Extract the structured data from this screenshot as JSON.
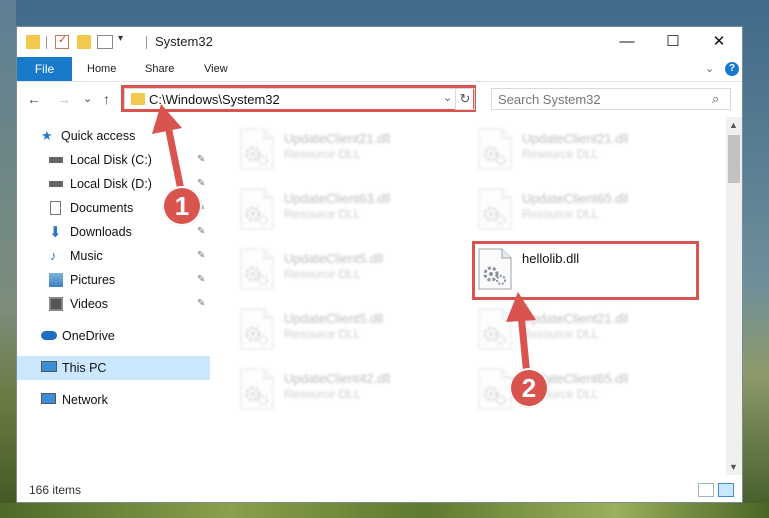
{
  "window": {
    "title": "System32",
    "minimize_glyph": "—",
    "maximize_glyph": "☐",
    "close_glyph": "✕"
  },
  "ribbon": {
    "tabs": [
      "File",
      "Home",
      "Share",
      "View"
    ],
    "help_glyph": "?",
    "expand_glyph": "⌄"
  },
  "nav": {
    "back_glyph": "←",
    "forward_glyph": "→",
    "recent_glyph": "⌄",
    "up_glyph": "↑",
    "address": "C:\\Windows\\System32",
    "refresh_glyph": "↻",
    "search_placeholder": "Search System32",
    "search_icon": "🔍"
  },
  "sidebar": {
    "items": [
      {
        "label": "Quick access",
        "icon": "star-icon",
        "pinned": false
      },
      {
        "label": "Local Disk (C:)",
        "icon": "drive-icon",
        "pinned": true
      },
      {
        "label": "Local Disk (D:)",
        "icon": "drive-icon",
        "pinned": true
      },
      {
        "label": "Documents",
        "icon": "document-icon",
        "pinned": true
      },
      {
        "label": "Downloads",
        "icon": "download-icon",
        "pinned": true
      },
      {
        "label": "Music",
        "icon": "music-icon",
        "pinned": true
      },
      {
        "label": "Pictures",
        "icon": "picture-icon",
        "pinned": true
      },
      {
        "label": "Videos",
        "icon": "video-icon",
        "pinned": true
      },
      {
        "label": "OneDrive",
        "icon": "cloud-icon",
        "pinned": false
      },
      {
        "label": "This PC",
        "icon": "computer-icon",
        "pinned": false,
        "selected": true
      },
      {
        "label": "Network",
        "icon": "network-icon",
        "pinned": false
      }
    ],
    "pin_glyph": "📌"
  },
  "files": [
    {
      "name": "UpdateClient21.dll",
      "type": "Resource DLL",
      "blurred": true
    },
    {
      "name": "UpdateClient21.dll",
      "type": "Resource DLL",
      "blurred": true
    },
    {
      "name": "UpdateClient63.dll",
      "type": "Resource DLL",
      "blurred": true
    },
    {
      "name": "UpdateClient65.dll",
      "type": "Resource DLL",
      "blurred": true
    },
    {
      "name": "UpdateClient5.dll",
      "type": "Resource DLL",
      "blurred": true
    },
    {
      "name": "hellolib.dll",
      "type": "",
      "blurred": false
    },
    {
      "name": "UpdateClient5.dll",
      "type": "Resource DLL",
      "blurred": true
    },
    {
      "name": "UpdateClient21.dll",
      "type": "Resource DLL",
      "blurred": true
    },
    {
      "name": "UpdateClient42.dll",
      "type": "Resource DLL",
      "blurred": true
    },
    {
      "name": "UpdateClient65.dll",
      "type": "Resource DLL",
      "blurred": true
    }
  ],
  "annotations": {
    "step1": "1",
    "step2": "2",
    "highlight_color": "#d9534f"
  },
  "status": {
    "item_count": "166 items"
  }
}
